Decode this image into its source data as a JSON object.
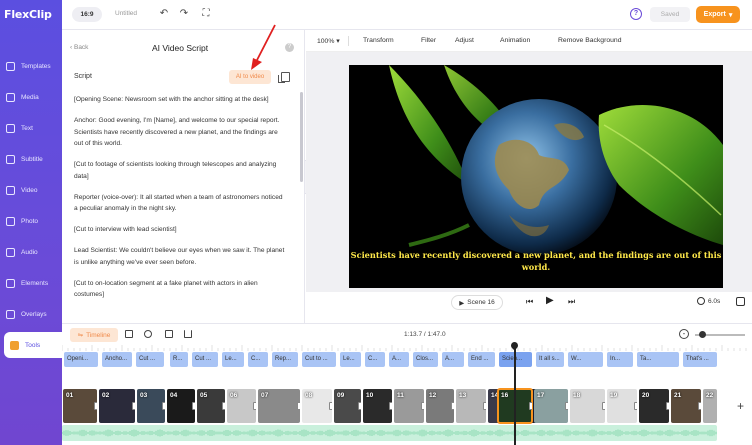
{
  "app": {
    "logo": "FlexClip",
    "aspect_ratio": "16:9",
    "doc_title": "Untitled"
  },
  "topbar": {
    "saved_label": "Saved",
    "export_label": "Export",
    "help_label": "?"
  },
  "sidebar": {
    "items": [
      {
        "label": "Templates",
        "icon": "templates-icon"
      },
      {
        "label": "Media",
        "icon": "media-icon"
      },
      {
        "label": "Text",
        "icon": "text-icon"
      },
      {
        "label": "Subtitle",
        "icon": "subtitle-icon"
      },
      {
        "label": "Video",
        "icon": "video-icon"
      },
      {
        "label": "Photo",
        "icon": "photo-icon"
      },
      {
        "label": "Audio",
        "icon": "audio-icon"
      },
      {
        "label": "Elements",
        "icon": "elements-icon"
      },
      {
        "label": "Overlays",
        "icon": "overlays-icon"
      },
      {
        "label": "Tools",
        "icon": "tools-icon",
        "active": true
      }
    ]
  },
  "panel": {
    "back_label": "Back",
    "title": "AI Video Script",
    "script_label": "Script",
    "ai_button": "AI to video",
    "paragraphs": [
      "[Opening Scene: Newsroom set with the anchor sitting at the desk]",
      "Anchor: Good evening, I'm [Name], and welcome to our special report. Scientists have recently discovered a new planet, and the findings are out of this world.",
      "[Cut to footage of scientists looking through telescopes and analyzing data]",
      "Reporter (voice-over): It all started when a team of astronomers noticed a peculiar anomaly in the night sky.",
      "[Cut to interview with lead scientist]",
      "Lead Scientist: We couldn't believe our eyes when we saw it. The planet is unlike anything we've ever seen before.",
      "[Cut to on-location segment at a fake planet with actors in alien costumes]"
    ]
  },
  "editor_toolbar": {
    "zoom": "100%",
    "items": [
      "Transform",
      "Filter",
      "Adjust",
      "Animation",
      "Remove Background"
    ]
  },
  "video": {
    "subtitle": "Scientists have recently discovered a new planet, and the findings are out of this world."
  },
  "playback": {
    "scene_label": "Scene 16",
    "duration": "6.0s"
  },
  "timeline": {
    "label": "Timeline",
    "time": "1:13.7 / 1:47.0",
    "subtitle_chips": [
      "Openi...",
      "Ancho...",
      "Cut ...",
      "R...",
      "Cut ...",
      "Le...",
      "C...",
      "Rep...",
      "Cut to ...",
      "Le...",
      "C...",
      "A...",
      "Clos...",
      "A...",
      "End ...",
      "Scien...",
      "It all s...",
      "W...",
      "In...",
      "Ta...",
      "That's ..."
    ],
    "scene_numbers": [
      "01",
      "02",
      "03",
      "04",
      "05",
      "06",
      "07",
      "08",
      "09",
      "10",
      "11",
      "12",
      "13",
      "14",
      "15",
      "16",
      "17",
      "18",
      "19",
      "20",
      "21",
      "22"
    ],
    "selected_scene": "16"
  },
  "colors": {
    "sidebar": "#5b4fe0",
    "accent": "#f7931e",
    "subtitle_text": "#ffe94a",
    "chip": "#a9c4f5",
    "audio": "#c9f0dc"
  }
}
